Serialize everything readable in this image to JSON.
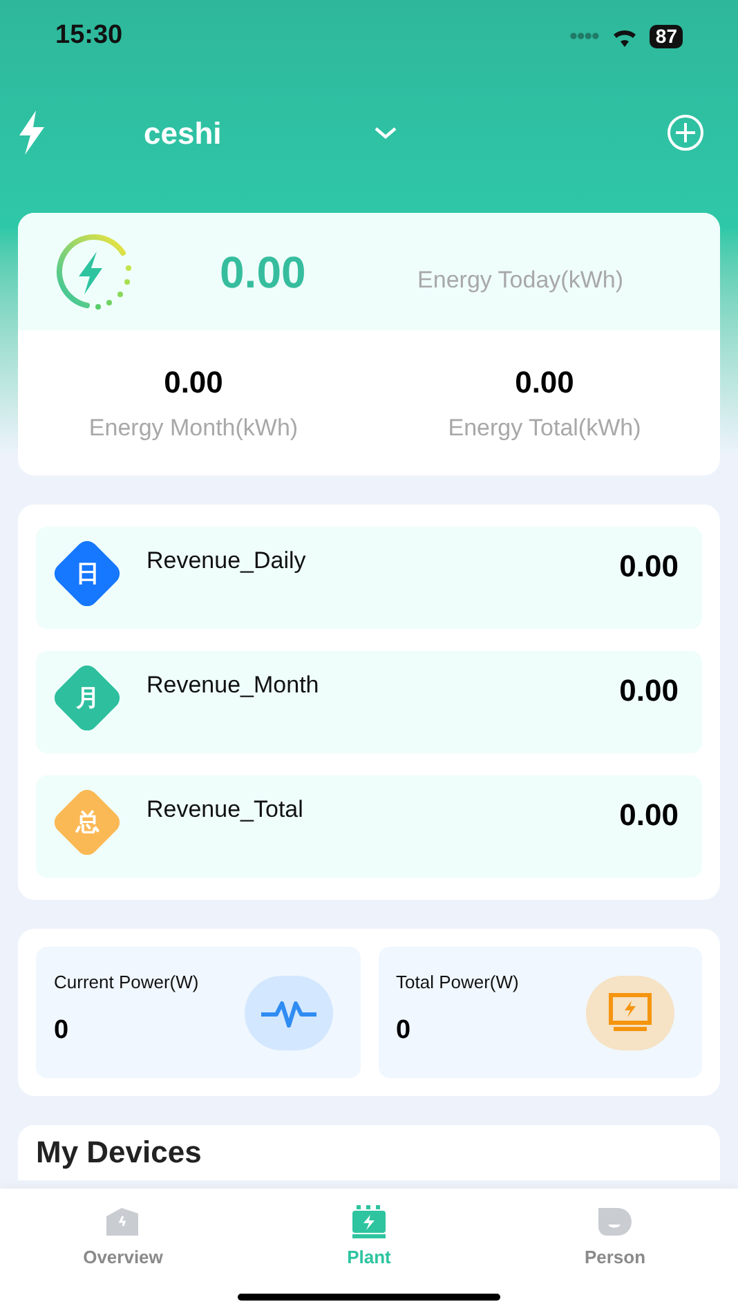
{
  "status_bar": {
    "time": "15:30",
    "battery": "87"
  },
  "header": {
    "plant_name": "ceshi"
  },
  "energy": {
    "today_value": "0.00",
    "today_label": "Energy Today(kWh)",
    "stats": [
      {
        "value": "0.00",
        "label": "Energy Month(kWh)"
      },
      {
        "value": "0.00",
        "label": "Energy Total(kWh)"
      }
    ]
  },
  "revenue": [
    {
      "badge": "日",
      "label": "Revenue_Daily",
      "value": "0.00",
      "color": "#1677ff"
    },
    {
      "badge": "月",
      "label": "Revenue_Month",
      "value": "0.00",
      "color": "#2ebf9f"
    },
    {
      "badge": "总",
      "label": "Revenue_Total",
      "value": "0.00",
      "color": "#fbb955"
    }
  ],
  "power": [
    {
      "kind": "pulse",
      "label": "Current Power(W)",
      "value": "0"
    },
    {
      "kind": "monitor",
      "label": "Total Power(W)",
      "value": "0"
    }
  ],
  "devices": {
    "title": "My Devices"
  },
  "tab_bar": [
    {
      "kind": "overview",
      "label": "Overview",
      "selected": false
    },
    {
      "kind": "plant",
      "label": "Plant",
      "selected": true
    },
    {
      "kind": "person",
      "label": "Person",
      "selected": false
    }
  ]
}
